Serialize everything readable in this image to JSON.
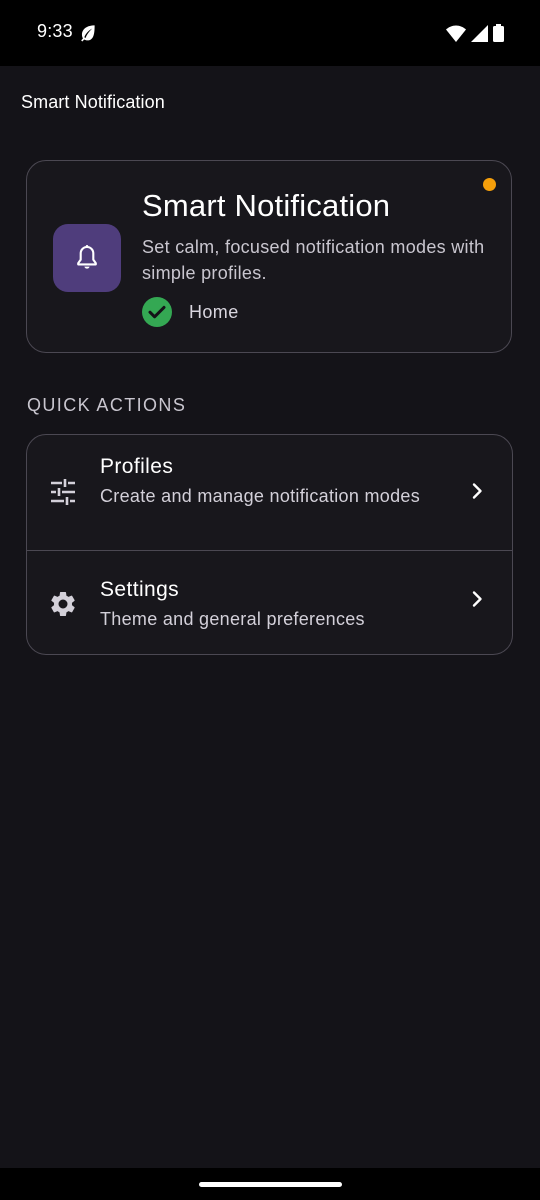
{
  "status_bar": {
    "time": "9:33",
    "icons": [
      "leaf-icon",
      "wifi-icon",
      "signal-icon",
      "battery-icon"
    ]
  },
  "app_bar": {
    "title": "Smart Notification"
  },
  "hero": {
    "title": "Smart Notification",
    "description": "Set calm, focused notification modes with simple profiles.",
    "icon": "bell-icon",
    "active_profile": "Home",
    "status_icon": "check-circle-icon",
    "indicator_color": "#f59f0b",
    "accent_color": "#4f3d7c"
  },
  "quick_actions": {
    "header": "QUICK ACTIONS",
    "items": [
      {
        "title": "Profiles",
        "subtitle": "Create and manage notification modes",
        "icon": "tune-sliders-icon"
      },
      {
        "title": "Settings",
        "subtitle": "Theme and general preferences",
        "icon": "gear-icon"
      }
    ]
  },
  "colors": {
    "background": "#141318",
    "card_border": "#4b4852",
    "success": "#34a853"
  }
}
